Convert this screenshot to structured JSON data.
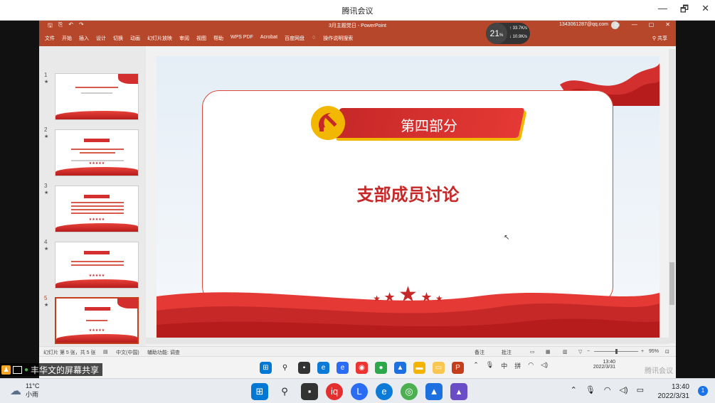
{
  "outer_window": {
    "title": "腾讯会议",
    "minimize": "—",
    "restore": "🗗",
    "close": "✕"
  },
  "ppt": {
    "title": "3月主题党日 - PowerPoint",
    "account": "1343061287@qq.com",
    "menus": [
      "文件",
      "开始",
      "插入",
      "设计",
      "切换",
      "动画",
      "幻灯片放映",
      "审阅",
      "视图",
      "帮助",
      "WPS PDF",
      "Acrobat",
      "百度网盘",
      "操作说明搜索"
    ],
    "share": "共享",
    "net_widget": {
      "percent": "21",
      "percent_unit": "%",
      "up": "33.7",
      "up_unit": "K/s",
      "down": "10.9",
      "down_unit": "K/s"
    },
    "thumbnails": [
      {
        "num": "1",
        "star": "★"
      },
      {
        "num": "2",
        "star": "★"
      },
      {
        "num": "3",
        "star": "★"
      },
      {
        "num": "4",
        "star": "★"
      },
      {
        "num": "5",
        "star": "★"
      }
    ],
    "slide": {
      "section": "第四部分",
      "title": "支部成员讨论",
      "stars": "★ ★ ★ ★ ★"
    },
    "status": {
      "slide_info": "幻灯片 第 5 张，共 5 张",
      "lang": "中文(中国)",
      "accessibility": "辅助功能: 调查",
      "notes": "备注",
      "comments": "批注",
      "zoom": "95%"
    },
    "inner_taskbar": {
      "time": "13:40",
      "date": "2022/3/31",
      "ime1": "中",
      "ime2": "拼",
      "watermark": "腾讯会议"
    }
  },
  "sharer": {
    "text": "丰华文的屏幕共享"
  },
  "host_taskbar": {
    "weather_temp": "11°C",
    "weather_desc": "小雨",
    "time": "13:40",
    "date": "2022/3/31",
    "notifications": "1"
  }
}
